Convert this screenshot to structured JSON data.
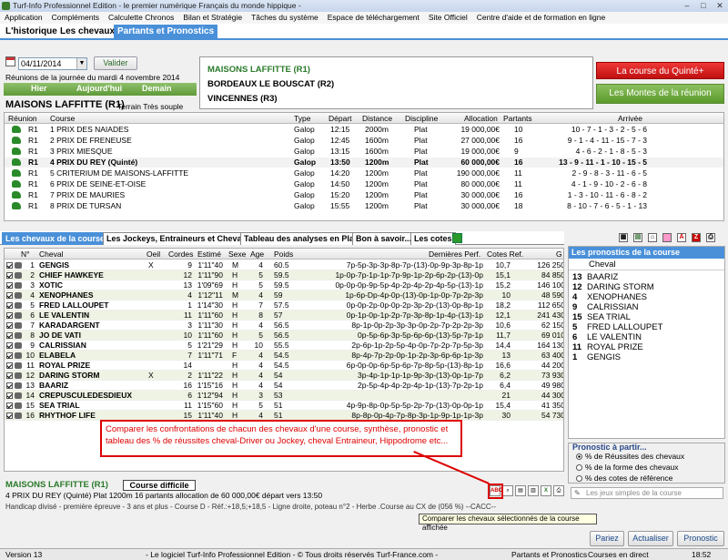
{
  "window": {
    "title": "Turf-Info Professionnel Edition - le premier numérique Français du monde hippique -"
  },
  "menu": [
    "Application",
    "Compléments",
    "Calculette Chronos",
    "Bilan et Stratégie",
    "Tâches du système",
    "Espace de téléchargement",
    "Site Officiel",
    "Centre d'aide et de formation en ligne"
  ],
  "top_tabs": [
    "L'historique",
    "Les chevaux",
    "Partants et Pronostics"
  ],
  "date": {
    "value": "04/11/2014",
    "validate_label": "Valider",
    "reunions_label": "Réunions de la journée du mardi 4 novembre 2014"
  },
  "day_nav": {
    "prev": "Hier",
    "today": "Aujourd'hui",
    "next": "Demain"
  },
  "meeting": {
    "title": "MAISONS LAFFITTE (R1)",
    "terrain": "Terrain Très souple"
  },
  "meetings_list": [
    "MAISONS LAFFITTE (R1)",
    "BORDEAUX LE BOUSCAT (R2)",
    "VINCENNES (R3)"
  ],
  "side_buttons": {
    "quinte": "La course du Quinté+",
    "montes": "Les Montes de la réunion"
  },
  "race_headers": [
    "Réunion",
    "Course",
    "Type",
    "Départ",
    "Distance",
    "Discipline",
    "Allocation",
    "Partants",
    "Arrivée"
  ],
  "races": [
    {
      "reunion": "R1",
      "course": "1 PRIX DES NAIADES",
      "type": "Galop",
      "depart": "12:15",
      "distance": "2000m",
      "discipline": "Plat",
      "allocation": "19 000,00€",
      "partants": "10",
      "arrivee": "10 - 7 - 1 - 3 - 2 - 5 - 6"
    },
    {
      "reunion": "R1",
      "course": "2 PRIX DE FRENEUSE",
      "type": "Galop",
      "depart": "12:45",
      "distance": "1600m",
      "discipline": "Plat",
      "allocation": "27 000,00€",
      "partants": "16",
      "arrivee": "9 - 1 - 4 - 11 - 15 - 7 - 3"
    },
    {
      "reunion": "R1",
      "course": "3 PRIX MIESQUE",
      "type": "Galop",
      "depart": "13:15",
      "distance": "1600m",
      "discipline": "Plat",
      "allocation": "19 000,00€",
      "partants": "9",
      "arrivee": "4 - 6 - 2 - 1 - 8 - 5 - 3"
    },
    {
      "reunion": "R1",
      "course": "4 PRIX DU REY (Quinté)",
      "type": "Galop",
      "depart": "13:50",
      "distance": "1200m",
      "discipline": "Plat",
      "allocation": "60 000,00€",
      "partants": "16",
      "arrivee": "13 - 9 - 11 - 1 - 10 - 15 - 5"
    },
    {
      "reunion": "R1",
      "course": "5 CRITERIUM DE MAISONS-LAFFITTE",
      "type": "Galop",
      "depart": "14:20",
      "distance": "1200m",
      "discipline": "Plat",
      "allocation": "190 000,00€",
      "partants": "11",
      "arrivee": "2 - 9 - 8 - 3 - 11 - 6 - 5"
    },
    {
      "reunion": "R1",
      "course": "6 PRIX DE SEINE-ET-OISE",
      "type": "Galop",
      "depart": "14:50",
      "distance": "1200m",
      "discipline": "Plat",
      "allocation": "80 000,00€",
      "partants": "11",
      "arrivee": "4 - 1 - 9 - 10 - 2 - 6 - 8"
    },
    {
      "reunion": "R1",
      "course": "7 PRIX DE MAURIES",
      "type": "Galop",
      "depart": "15:20",
      "distance": "1200m",
      "discipline": "Plat",
      "allocation": "30 000,00€",
      "partants": "16",
      "arrivee": "1 - 3 - 10 - 11 - 6 - 8 - 2"
    },
    {
      "reunion": "R1",
      "course": "8 PRIX DE TURSAN",
      "type": "Galop",
      "depart": "15:55",
      "distance": "1200m",
      "discipline": "Plat",
      "allocation": "30 000,00€",
      "partants": "18",
      "arrivee": "8 - 10 - 7 - 6 - 5 - 1 - 13"
    }
  ],
  "main_tabs": [
    "Les chevaux de la course",
    "Les Jockeys, Entraineurs et Chevaux",
    "Tableau des analyses en Plat",
    "Bon à savoir...",
    "Les cotes"
  ],
  "horse_headers": [
    "N°",
    "Cheval",
    "Oeil",
    "Cordes",
    "Estimé",
    "Sexe",
    "Age",
    "Poids",
    "Dernières Perf.",
    "Cotes Ref.",
    "G"
  ],
  "horses": [
    {
      "n": "1",
      "cheval": "GENGIS",
      "oeil": "X",
      "cordes": "9",
      "estime": "1'11\"40",
      "sexe": "M",
      "age": "4",
      "poids": "60.5",
      "perf": "7p-5p-3p-3p-8p-7p-(13)-0p-9p-3p-8p-1p",
      "cote": "10,7",
      "g": "126 250"
    },
    {
      "n": "2",
      "cheval": "CHIEF HAWKEYE",
      "oeil": "",
      "cordes": "12",
      "estime": "1'11\"90",
      "sexe": "H",
      "age": "5",
      "poids": "59.5",
      "perf": "1p-0p-7p-1p-1p-7p-9p-1p-2p-6p-2p-(13)-0p",
      "cote": "15,1",
      "g": "84 850"
    },
    {
      "n": "3",
      "cheval": "XOTIC",
      "oeil": "",
      "cordes": "13",
      "estime": "1'09\"69",
      "sexe": "H",
      "age": "5",
      "poids": "59.5",
      "perf": "0p-0p-0p-9p-5p-4p-2p-4p-2p-4p-5p-(13)-1p",
      "cote": "15,2",
      "g": "146 100"
    },
    {
      "n": "4",
      "cheval": "XENOPHANES",
      "oeil": "",
      "cordes": "4",
      "estime": "1'12\"11",
      "sexe": "M",
      "age": "4",
      "poids": "59",
      "perf": "1p-6p-Dp-4p-0p-(13)-0p-1p-0p-7p-2p-3p",
      "cote": "10",
      "g": "48 590"
    },
    {
      "n": "5",
      "cheval": "FRED LALLOUPET",
      "oeil": "",
      "cordes": "1",
      "estime": "1'14\"30",
      "sexe": "H",
      "age": "7",
      "poids": "57.5",
      "perf": "0p-0p-2p-0p-0p-2p-3p-2p-(13)-0p-8p-1p",
      "cote": "18,2",
      "g": "112 650"
    },
    {
      "n": "6",
      "cheval": "LE VALENTIN",
      "oeil": "",
      "cordes": "11",
      "estime": "1'11\"60",
      "sexe": "H",
      "age": "8",
      "poids": "57",
      "perf": "0p-1p-0p-1p-2p-7p-3p-8p-1p-4p-(13)-1p",
      "cote": "12,1",
      "g": "241 430"
    },
    {
      "n": "7",
      "cheval": "KARADARGENT",
      "oeil": "",
      "cordes": "3",
      "estime": "1'11\"30",
      "sexe": "H",
      "age": "4",
      "poids": "56.5",
      "perf": "8p-1p-0p-2p-3p-3p-0p-2p-7p-2p-2p-3p",
      "cote": "10,6",
      "g": "62 150"
    },
    {
      "n": "8",
      "cheval": "JO DE VATI",
      "oeil": "",
      "cordes": "10",
      "estime": "1'11\"60",
      "sexe": "H",
      "age": "5",
      "poids": "56.5",
      "perf": "0p-5p-6p-3p-5p-6p-6p-(13)-5p-7p-1p",
      "cote": "11,7",
      "g": "69 010"
    },
    {
      "n": "9",
      "cheval": "CALRISSIAN",
      "oeil": "",
      "cordes": "5",
      "estime": "1'21\"29",
      "sexe": "H",
      "age": "10",
      "poids": "55.5",
      "perf": "2p-6p-1p-2p-5p-4p-0p-7p-2p-7p-5p-3p",
      "cote": "14,4",
      "g": "164 130"
    },
    {
      "n": "10",
      "cheval": "ELABELA",
      "oeil": "",
      "cordes": "7",
      "estime": "1'11\"71",
      "sexe": "F",
      "age": "4",
      "poids": "54.5",
      "perf": "8p-4p-7p-2p-0p-1p-2p-3p-6p-6p-1p-3p",
      "cote": "13",
      "g": "63 400"
    },
    {
      "n": "11",
      "cheval": "ROYAL PRIZE",
      "oeil": "",
      "cordes": "14",
      "estime": "",
      "sexe": "H",
      "age": "4",
      "poids": "54.5",
      "perf": "6p-0p-0p-6p-5p-6p-7p-8p-5p-(13)-8p-1p",
      "cote": "16,6",
      "g": "44 200"
    },
    {
      "n": "12",
      "cheval": "DARING STORM",
      "oeil": "X",
      "cordes": "2",
      "estime": "1'11\"22",
      "sexe": "H",
      "age": "4",
      "poids": "54",
      "perf": "3p-4p-1p-1p-1p-9p-3p-(13)-0p-1p-7p",
      "cote": "6,2",
      "g": "73 930"
    },
    {
      "n": "13",
      "cheval": "BAARIZ",
      "oeil": "",
      "cordes": "16",
      "estime": "1'15\"16",
      "sexe": "H",
      "age": "4",
      "poids": "54",
      "perf": "2p-5p-4p-4p-2p-4p-1p-(13)-7p-2p-1p",
      "cote": "6,4",
      "g": "49 980"
    },
    {
      "n": "14",
      "cheval": "CREPUSCULEDESDIEUX",
      "oeil": "",
      "cordes": "6",
      "estime": "1'12\"94",
      "sexe": "H",
      "age": "3",
      "poids": "53",
      "perf": "",
      "cote": "21",
      "g": "44 300"
    },
    {
      "n": "15",
      "cheval": "SEA TRIAL",
      "oeil": "",
      "cordes": "11",
      "estime": "1'15\"60",
      "sexe": "H",
      "age": "5",
      "poids": "51",
      "perf": "4p-9p-8p-0p-5p-5p-2p-7p-(13)-0p-0p-1p",
      "cote": "15,4",
      "g": "41 350"
    },
    {
      "n": "16",
      "cheval": "RHYTHOF LIFE",
      "oeil": "",
      "cordes": "15",
      "estime": "1'11\"40",
      "sexe": "H",
      "age": "4",
      "poids": "51",
      "perf": "8p-8p-0p-4p-7p-8p-3p-1p-9p-1p-1p-3p",
      "cote": "30",
      "g": "54 730"
    }
  ],
  "callout": "Comparer les confrontations de chacun des chevaux d'une course, synthèse, pronostic et tableau des % de réussites cheval-Driver ou Jockey, cheval Entraineur, Hippodrome etc...",
  "prono": {
    "title": "Les pronostics de la course",
    "col": "Cheval",
    "items": [
      {
        "n": "13",
        "name": "BAARIZ"
      },
      {
        "n": "12",
        "name": "DARING STORM"
      },
      {
        "n": "4",
        "name": "XENOPHANES"
      },
      {
        "n": "9",
        "name": "CALRISSIAN"
      },
      {
        "n": "15",
        "name": "SEA TRIAL"
      },
      {
        "n": "5",
        "name": "FRED LALLOUPET"
      },
      {
        "n": "6",
        "name": "LE VALENTIN"
      },
      {
        "n": "11",
        "name": "ROYAL PRIZE"
      },
      {
        "n": "1",
        "name": "GENGIS"
      }
    ]
  },
  "prono_apartir": {
    "label": "Pronostic à partir...",
    "options": [
      "% de Réussites des chevaux",
      "% de la forme des chevaux",
      "% des cotes de référence"
    ]
  },
  "search_jeux_placeholder": "Les jeux simples de la course",
  "footer": {
    "meeting": "MAISONS LAFFITTE (R1)",
    "difficulty": "Course difficile",
    "info": "4 PRIX DU REY (Quinté) Plat 1200m 16 partants allocation de 60 000,00€ départ vers 13:50",
    "handicap": "Handicap divisé - première épreuve - 3 ans et plus - Course D - Réf.:+18,5;+18,5 - Ligne droite, poteau n°2 - Herbe .Course au CX de (056 %) --CACC--",
    "tooltip": "Comparer les chevaux sélectionnés de la course affichée"
  },
  "bottom_buttons": [
    "Pariez",
    "Actualiser",
    "Pronostic"
  ],
  "status": {
    "version": "Version 13",
    "copyright": "- Le logiciel Turf-Info Professionnel Edition - © Tous droits réservés Turf-France.com -",
    "section": "Partants et Pronostics",
    "live": "Courses en direct",
    "time": "18:52"
  }
}
